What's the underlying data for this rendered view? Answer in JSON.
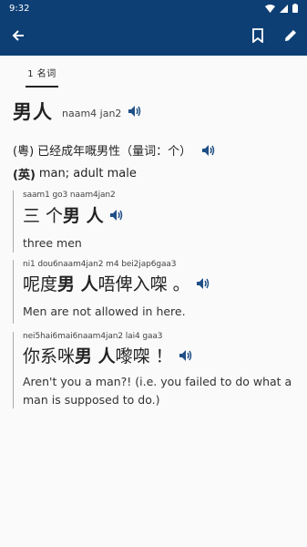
{
  "status_bar": {
    "time": "9:32"
  },
  "tabs": [
    {
      "label": "1 名词"
    }
  ],
  "entry": {
    "headword": "男人",
    "jyutping": "naam4 jan2",
    "definitions": [
      {
        "tag": "(粵)",
        "text": "已经成年嘅男性（量词：个）"
      },
      {
        "tag": "(英)",
        "text": "man; adult male"
      }
    ],
    "examples": [
      {
        "jyutping": "saam1 go3 naam4jan2",
        "pre": "三 个 ",
        "word": "男 人",
        "post": "",
        "english": "three men"
      },
      {
        "jyutping": "ni1 dou6naam4jan2 m4 bei2jap6gaa3",
        "pre": "呢度 ",
        "word": "男 人",
        "post": "唔俾入㗎 。",
        "english": "Men are not allowed in here."
      },
      {
        "jyutping": "nei5hai6mai6naam4jan2 lai4 gaa3",
        "pre": "你系咪 ",
        "word": "男 人",
        "post": "嚟㗎 ！",
        "english": "Aren't you a man?! (i.e. you failed to do what a man is supposed to do.)"
      }
    ]
  }
}
